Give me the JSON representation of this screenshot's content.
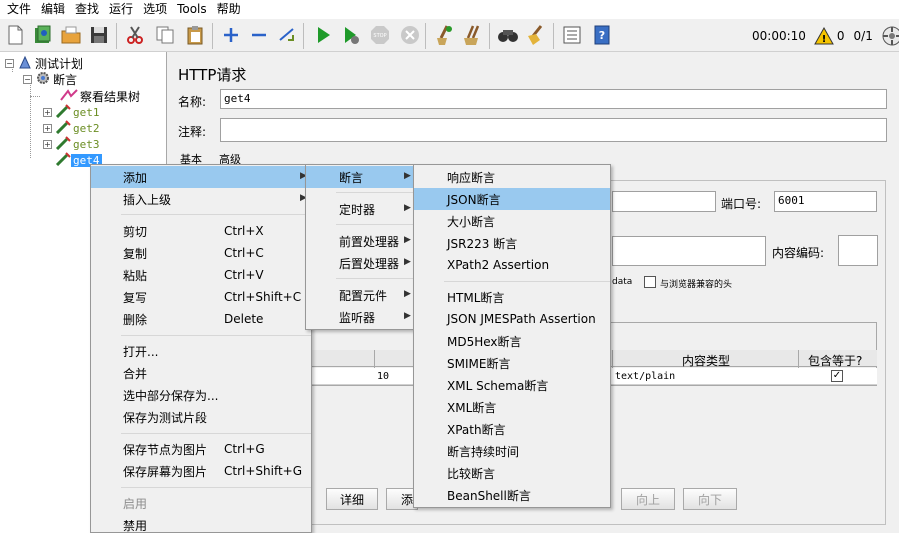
{
  "menubar": [
    "文件",
    "编辑",
    "查找",
    "运行",
    "选项",
    "Tools",
    "帮助"
  ],
  "toolbar": {
    "icons": [
      "new-icon",
      "templates-icon",
      "open-icon",
      "save-icon",
      "cut-icon",
      "copy-icon",
      "paste-icon",
      "expand-icon",
      "collapse-icon",
      "toggle-icon",
      "start-icon",
      "start-no-pause-icon",
      "stop-icon",
      "shutdown-icon",
      "clear-icon",
      "clear-all-icon",
      "search-icon",
      "reset-search-icon",
      "function-helper-icon",
      "help-icon"
    ],
    "timer": "00:00:10",
    "warnings": "0",
    "threads": "0/1"
  },
  "tree": {
    "root": "测试计划",
    "group": "断言",
    "listener": "察看结果树",
    "samplers": [
      "get1",
      "get2",
      "get3",
      "get4"
    ]
  },
  "panel": {
    "title": "HTTP请求",
    "name_label": "名称:",
    "name_value": "get4",
    "comment_label": "注释:",
    "tab_basic": "基本",
    "tab_advanced": "高级",
    "port_label": "端口号:",
    "port_value": "6001",
    "encoding_label": "内容编码:",
    "data_fragment": "data",
    "browser_headers": "与浏览器兼容的头",
    "col_content_type": "内容类型",
    "col_include_equals": "包含等于?",
    "row_value": "10",
    "row_content_type": "text/plain",
    "btn_detail": "详细",
    "btn_add_fragment": "添",
    "btn_up": "向上",
    "btn_down": "向下"
  },
  "ctx_menu": {
    "items": [
      {
        "label": "添加",
        "shortcut": "",
        "sub": true
      },
      {
        "label": "插入上级",
        "shortcut": "",
        "sub": true
      },
      {
        "label": "剪切",
        "shortcut": "Ctrl+X"
      },
      {
        "label": "复制",
        "shortcut": "Ctrl+C"
      },
      {
        "label": "粘贴",
        "shortcut": "Ctrl+V"
      },
      {
        "label": "复写",
        "shortcut": "Ctrl+Shift+C"
      },
      {
        "label": "删除",
        "shortcut": "Delete"
      },
      {
        "label": "打开..."
      },
      {
        "label": "合并"
      },
      {
        "label": "选中部分保存为..."
      },
      {
        "label": "保存为测试片段"
      },
      {
        "label": "保存节点为图片",
        "shortcut": "Ctrl+G"
      },
      {
        "label": "保存屏幕为图片",
        "shortcut": "Ctrl+Shift+G"
      },
      {
        "label": "启用"
      },
      {
        "label": "禁用"
      }
    ]
  },
  "add_menu": [
    "断言",
    "定时器",
    "前置处理器",
    "后置处理器",
    "配置元件",
    "监听器"
  ],
  "assert_menu": [
    "响应断言",
    "JSON断言",
    "大小断言",
    "JSR223 断言",
    "XPath2 Assertion",
    "HTML断言",
    "JSON JMESPath Assertion",
    "MD5Hex断言",
    "SMIME断言",
    "XML Schema断言",
    "XML断言",
    "XPath断言",
    "断言持续时间",
    "比较断言",
    "BeanShell断言"
  ],
  "colors": {
    "highlight": "#99c9ef",
    "selected_tree": "#3399ff"
  }
}
